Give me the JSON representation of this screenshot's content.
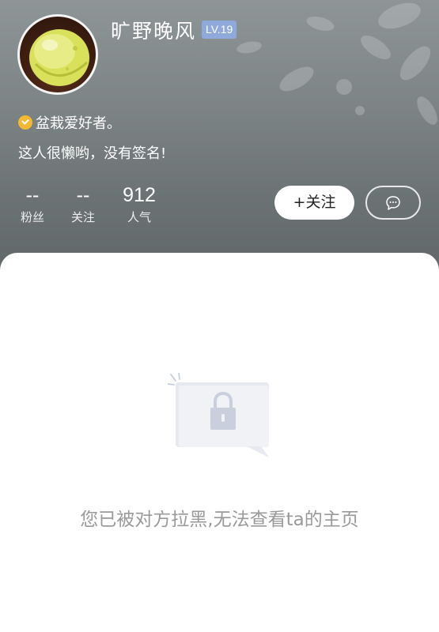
{
  "profile": {
    "username": "旷野晚风",
    "level": "LV.19",
    "tag": "盆栽爱好者。",
    "signature": "这人很懒哟，没有签名!"
  },
  "stats": {
    "fans": {
      "value": "--",
      "label": "粉丝"
    },
    "following": {
      "value": "--",
      "label": "关注"
    },
    "popularity": {
      "value": "912",
      "label": "人气"
    }
  },
  "actions": {
    "follow_label": "+关注",
    "message_icon": "chat-bubble-icon"
  },
  "content": {
    "blocked_message": "您已被对方拉黑,无法查看ta的主页",
    "illustration_icon": "lock-icon"
  },
  "colors": {
    "level_badge": "#8fa9dc",
    "tag_icon": "#f5b833",
    "blocked_text": "#9a9a9a"
  }
}
